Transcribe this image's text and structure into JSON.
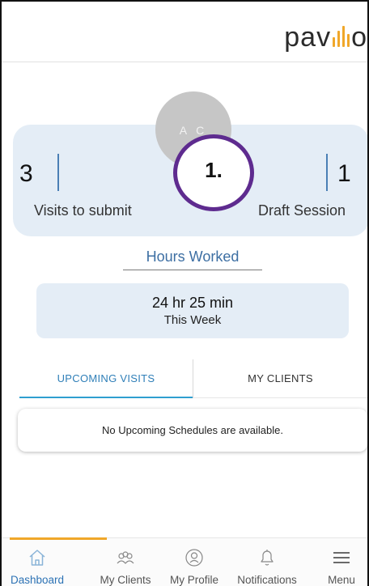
{
  "header": {
    "logo_text_start": "pav",
    "logo_text_end": "o"
  },
  "profile": {
    "initials": "A C"
  },
  "stats": {
    "visits_to_submit_count": "3",
    "visits_to_submit_label": "Visits to submit",
    "draft_session_count": "1",
    "draft_session_label": "Draft Session"
  },
  "callout": {
    "label": "1."
  },
  "hours": {
    "title": "Hours Worked",
    "value": "24 hr 25 min",
    "period": "This Week"
  },
  "tabs": [
    {
      "label": "UPCOMING VISITS",
      "active": true
    },
    {
      "label": "MY CLIENTS",
      "active": false
    }
  ],
  "upcoming": {
    "empty_message": "No Upcoming Schedules are available."
  },
  "bottom_nav": [
    {
      "label": "Dashboard",
      "icon": "home-icon",
      "active": true
    },
    {
      "label": "My Clients",
      "icon": "clients-icon",
      "active": false
    },
    {
      "label": "My Profile",
      "icon": "profile-icon",
      "active": false
    },
    {
      "label": "Notifications",
      "icon": "bell-icon",
      "active": false
    },
    {
      "label": "Menu",
      "icon": "hamburger-menu-icon",
      "active": false
    }
  ],
  "colors": {
    "accent_orange": "#f0a72a",
    "primary_blue": "#2d73b5",
    "card_bg": "#e4edf6",
    "callout_purple": "#5e2b8f"
  }
}
